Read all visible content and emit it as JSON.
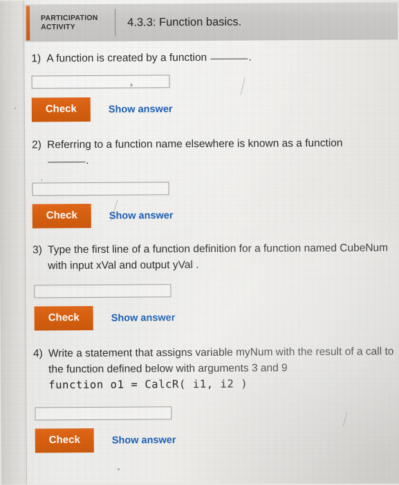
{
  "header": {
    "activity_label": "PARTICIPATION\nACTIVITY",
    "title": "4.3.3: Function basics."
  },
  "colors": {
    "accent_orange": "#d9600f",
    "link_blue": "#1a5fb4",
    "header_band": "#cbcac8",
    "page": "#eeeeec"
  },
  "labels": {
    "check": "Check",
    "show_answer": "Show answer",
    "input_placeholder": "",
    "input_value": ""
  },
  "questions": [
    {
      "number": "1)",
      "prompt_before_blank": "A function is created by a function ",
      "prompt_after_blank": ".",
      "has_blank": true,
      "wrap": false,
      "code": "",
      "second_line": ""
    },
    {
      "number": "2)",
      "prompt_before_blank": "Referring to a function name elsewhere is known as a function",
      "prompt_after_blank": ".",
      "has_blank": true,
      "wrap": false,
      "code": "",
      "second_line": "blank-on-own-line"
    },
    {
      "number": "3)",
      "prompt_before_blank": "Type the first line of a function definition for a function named CubeNum with input xVal and output yVal .",
      "prompt_after_blank": "",
      "has_blank": false,
      "wrap": true,
      "code": "",
      "second_line": ""
    },
    {
      "number": "4)",
      "prompt_before_blank": "Write a statement that assigns variable myNum with the result of a call to the function defined below with arguments 3 and 9",
      "prompt_after_blank": "",
      "has_blank": false,
      "wrap": true,
      "code": "function o1 = CalcR( i1, i2 )",
      "second_line": ""
    }
  ]
}
